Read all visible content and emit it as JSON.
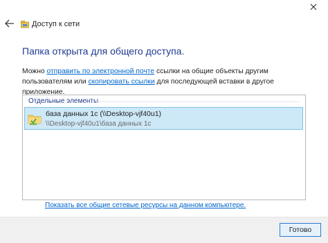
{
  "window": {
    "title": "Доступ к сети",
    "close_glyph": "✕",
    "back_glyph": "←"
  },
  "main": {
    "heading": "Папка открыта для общего доступа.",
    "description": {
      "part1": "Можно ",
      "email_link": "отправить по электронной почте",
      "part2": " ссылки на общие объекты другим пользователям или ",
      "copy_link": "скопировать ссылки",
      "part3": " для последующей вставки в другое приложение."
    },
    "group_header": "Отдельные элементы",
    "items": [
      {
        "name": "база данных 1с (\\\\Desktop-vjf40u1)",
        "path": "\\\\Desktop-vjf40u1\\база данных 1с",
        "icon": "shared-folder-icon"
      }
    ],
    "show_all_link": "Показать все общие сетевые ресурсы на данном компьютере."
  },
  "footer": {
    "done_label": "Готово"
  },
  "colors": {
    "heading": "#1f3a93",
    "link": "#0066cc",
    "selection_bg": "#cde8f7",
    "selection_border": "#7fc0e6",
    "footer_bg": "#f0f0f0",
    "button_border": "#2b78d6"
  }
}
